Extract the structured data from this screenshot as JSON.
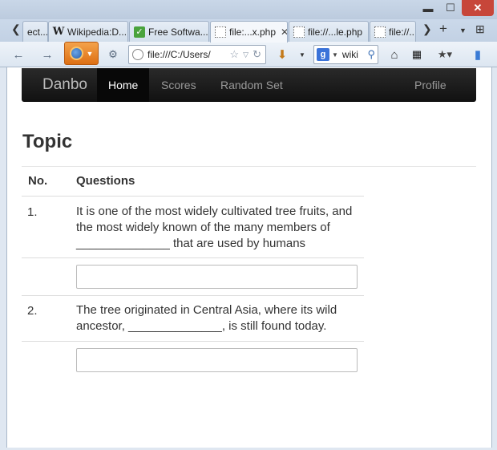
{
  "browser": {
    "window_controls": {
      "minimize": "▬",
      "maximize": "☐",
      "close": "✕"
    },
    "tabs": [
      {
        "label": "ect...",
        "icon": "none"
      },
      {
        "label": "Wikipedia:D...",
        "icon": "wikipedia-icon"
      },
      {
        "label": "Free Softwa...",
        "icon": "check-icon"
      },
      {
        "label": "file:...x.php",
        "icon": "page-icon",
        "active": true
      },
      {
        "label": "file://...le.php",
        "icon": "page-icon"
      },
      {
        "label": "file://...",
        "icon": "page-icon"
      }
    ],
    "url": "file:///C:/Users/",
    "search_engine": "g",
    "search_text": "wiki"
  },
  "site": {
    "brand": "Danbo",
    "nav": [
      {
        "label": "Home",
        "active": true
      },
      {
        "label": "Scores"
      },
      {
        "label": "Random Set"
      }
    ],
    "profile": "Profile"
  },
  "page": {
    "title": "Topic",
    "columns": {
      "number": "No.",
      "questions": "Questions"
    },
    "questions": [
      {
        "number": "1.",
        "text": "It is one of the most widely cultivated tree fruits, and the most widely known of the many members of ______________ that are used by humans",
        "answer": ""
      },
      {
        "number": "2.",
        "text": "The tree originated in Central Asia, where its wild ancestor, ______________, is still found today.",
        "answer": ""
      }
    ]
  }
}
